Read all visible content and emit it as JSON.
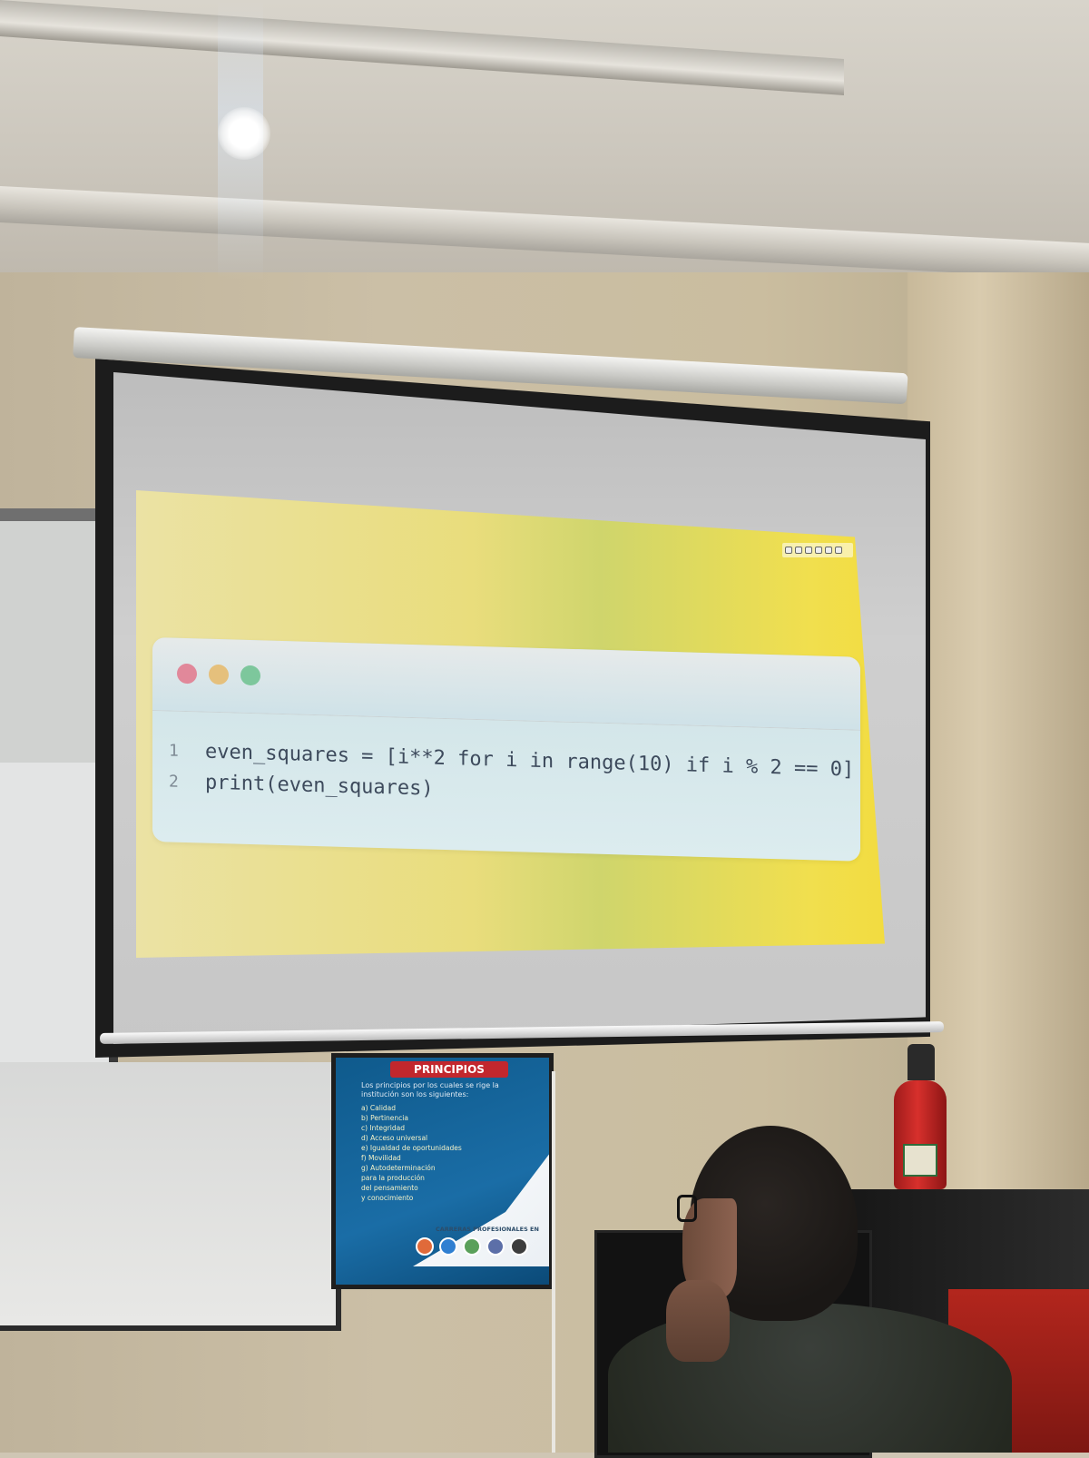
{
  "slide": {
    "code_lines": [
      {
        "number": "1",
        "code": "even_squares = [i**2 for i in range(10) if i % 2 == 0]"
      },
      {
        "number": "2",
        "code": "print(even_squares)"
      }
    ]
  },
  "poster": {
    "title": "PRINCIPIOS",
    "intro": "Los principios por los cuales se rige la institución son los siguientes:",
    "items": [
      "a) Calidad",
      "b) Pertinencia",
      "c) Integridad",
      "d) Acceso universal",
      "e) Igualdad de oportunidades",
      "f) Movilidad",
      "g) Autodeterminación",
      "para la producción",
      "del pensamiento",
      "y conocimiento"
    ],
    "careers_label": "CARRERAS PROFESIONALES EN"
  },
  "colors": {
    "slide_gradient_start": "#ebe2a4",
    "slide_gradient_end": "#f2dc40",
    "code_window": "#d6e9ec",
    "dot_red": "#e1889a",
    "dot_yellow": "#e5c07c",
    "dot_green": "#7dc79c",
    "poster_blue": "#1a6da6",
    "poster_title_red": "#c2272d"
  },
  "icons": [
    "red-dot-icon",
    "yellow-dot-icon",
    "green-dot-icon"
  ]
}
